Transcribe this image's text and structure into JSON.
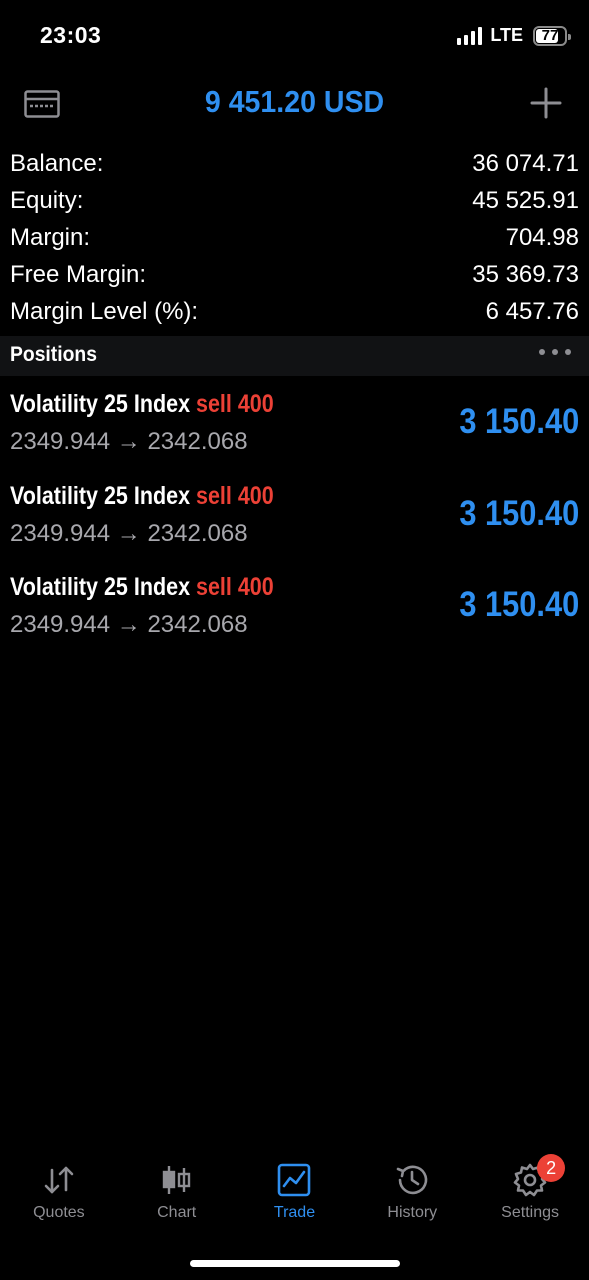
{
  "status_bar": {
    "time": "23:03",
    "network": "LTE",
    "battery": "77"
  },
  "header": {
    "title": "9 451.20 USD",
    "left_icon": "account-card-icon",
    "right_icon": "plus-icon"
  },
  "summary": [
    {
      "label": "Balance:",
      "value": "36 074.71"
    },
    {
      "label": "Equity:",
      "value": "45 525.91"
    },
    {
      "label": "Margin:",
      "value": "704.98"
    },
    {
      "label": "Free Margin:",
      "value": "35 369.73"
    },
    {
      "label": "Margin Level (%):",
      "value": "6 457.76"
    }
  ],
  "positions_section": {
    "title": "Positions"
  },
  "positions": [
    {
      "symbol": "Volatility 25 Index",
      "type": "sell 400",
      "prices": "2349.944 → 2342.068",
      "profit": "3 150.40"
    },
    {
      "symbol": "Volatility 25 Index",
      "type": "sell 400",
      "prices": "2349.944 → 2342.068",
      "profit": "3 150.40"
    },
    {
      "symbol": "Volatility 25 Index",
      "type": "sell 400",
      "prices": "2349.944 → 2342.068",
      "profit": "3 150.40"
    }
  ],
  "tabbar": {
    "tabs": [
      {
        "label": "Quotes",
        "icon": "quotes-arrows-icon",
        "active": false
      },
      {
        "label": "Chart",
        "icon": "candlestick-icon",
        "active": false
      },
      {
        "label": "Trade",
        "icon": "trade-chart-icon",
        "active": true
      },
      {
        "label": "History",
        "icon": "history-clock-icon",
        "active": false
      },
      {
        "label": "Settings",
        "icon": "gear-icon",
        "active": false,
        "badge": "2"
      }
    ]
  },
  "colors": {
    "accent": "#2f8ff0",
    "sell": "#ec4136",
    "muted": "#8e8e93",
    "background": "#000000"
  }
}
